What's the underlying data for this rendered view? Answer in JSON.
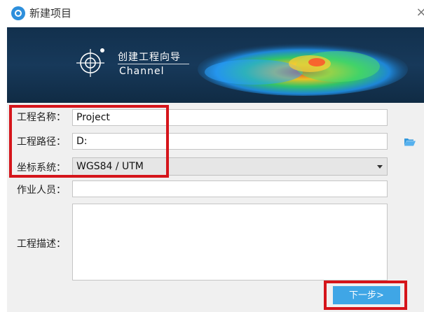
{
  "window": {
    "title": "新建项目",
    "close_glyph": "×"
  },
  "banner": {
    "title_cn": "创建工程向导",
    "subtitle": "Channel"
  },
  "form": {
    "project_name": {
      "label": "工程名称：",
      "value": "Project"
    },
    "project_path": {
      "label": "工程路径：",
      "value": "D:"
    },
    "coordinate_system": {
      "label": "坐标系统：",
      "value": "WGS84 / UTM"
    },
    "operator": {
      "label": "作业人员：",
      "value": ""
    },
    "description": {
      "label": "工程描述：",
      "value": ""
    }
  },
  "buttons": {
    "next_label": "下一步>"
  },
  "icons": [
    "app-logo-icon",
    "close-icon",
    "channel-emblem-icon",
    "folder-open-icon",
    "dropdown-arrow-icon"
  ],
  "colors": {
    "highlight_red": "#d5151b",
    "next_button": "#3fa6e6",
    "banner_bg": "#17395a",
    "folder_icon": "#3399dd"
  }
}
